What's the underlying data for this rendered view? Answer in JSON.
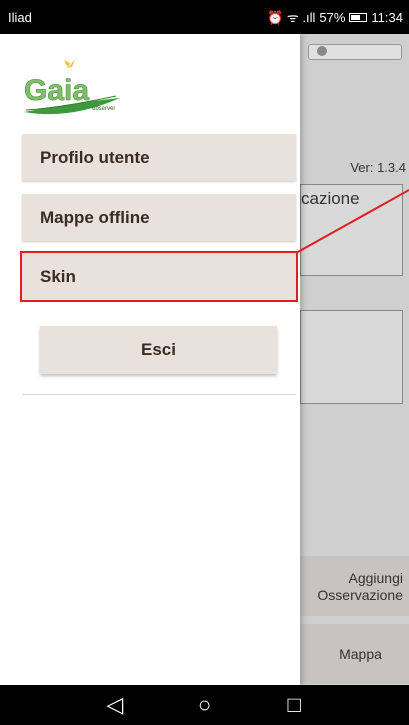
{
  "status_bar": {
    "carrier": "Iliad",
    "icons": "⏰ ᯤ .ıll",
    "battery": "57%",
    "time": "11:34"
  },
  "background_app": {
    "version": "Ver: 1.3.4",
    "field_text": "cazione",
    "add_button": "Aggiungi Osservazione",
    "map_button": "Mappa"
  },
  "drawer": {
    "logo_text": "Gaia",
    "logo_subtext": "observer",
    "menu": [
      {
        "label": "Profilo utente"
      },
      {
        "label": "Mappe offline"
      },
      {
        "label": "Skin"
      }
    ],
    "exit_label": "Esci"
  },
  "nav_bar": {
    "back": "◁",
    "home": "○",
    "recents": "□"
  },
  "colors": {
    "accent_highlight": "#e02020",
    "button_bg": "#e8e1dc",
    "logo_green": "#3c9a3c"
  }
}
